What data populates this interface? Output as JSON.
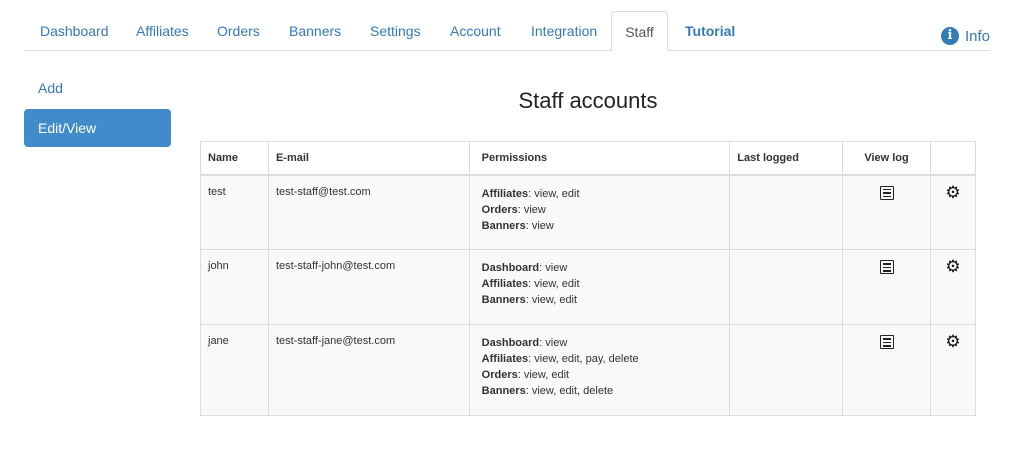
{
  "nav": {
    "tabs": [
      {
        "label": "Dashboard"
      },
      {
        "label": "Affiliates"
      },
      {
        "label": "Orders"
      },
      {
        "label": "Banners"
      },
      {
        "label": "Settings"
      },
      {
        "label": "Account"
      },
      {
        "label": "Integration"
      },
      {
        "label": "Staff",
        "active": true
      },
      {
        "label": "Tutorial"
      }
    ],
    "info_label": "Info",
    "info_icon": "info-circle-icon"
  },
  "sidebar": {
    "items": [
      {
        "label": "Add"
      },
      {
        "label": "Edit/View",
        "active": true
      }
    ]
  },
  "main": {
    "title": "Staff accounts",
    "table": {
      "headers": [
        "Name",
        "E-mail",
        "Permissions",
        "Last logged",
        "View log",
        ""
      ],
      "rows": [
        {
          "name": "test",
          "email": "test-staff@test.com",
          "permissions": [
            {
              "area": "Affiliates",
              "rights": ": view, edit"
            },
            {
              "area": "Orders",
              "rights": ": view"
            },
            {
              "area": "Banners",
              "rights": ": view"
            }
          ],
          "last_logged": ""
        },
        {
          "name": "john",
          "email": "test-staff-john@test.com",
          "permissions": [
            {
              "area": "Dashboard",
              "rights": ": view"
            },
            {
              "area": "Affiliates",
              "rights": ": view, edit"
            },
            {
              "area": "Banners",
              "rights": ": view, edit"
            }
          ],
          "last_logged": ""
        },
        {
          "name": "jane",
          "email": "test-staff-jane@test.com",
          "permissions": [
            {
              "area": "Dashboard",
              "rights": ": view"
            },
            {
              "area": "Affiliates",
              "rights": ": view, edit, pay, delete"
            },
            {
              "area": "Orders",
              "rights": ": view, edit"
            },
            {
              "area": "Banners",
              "rights": ": view, edit, delete"
            }
          ],
          "last_logged": ""
        }
      ]
    }
  },
  "colors": {
    "link": "#337ab7",
    "active_sidebar": "#428bca",
    "row_background": "#f9f9f9"
  }
}
